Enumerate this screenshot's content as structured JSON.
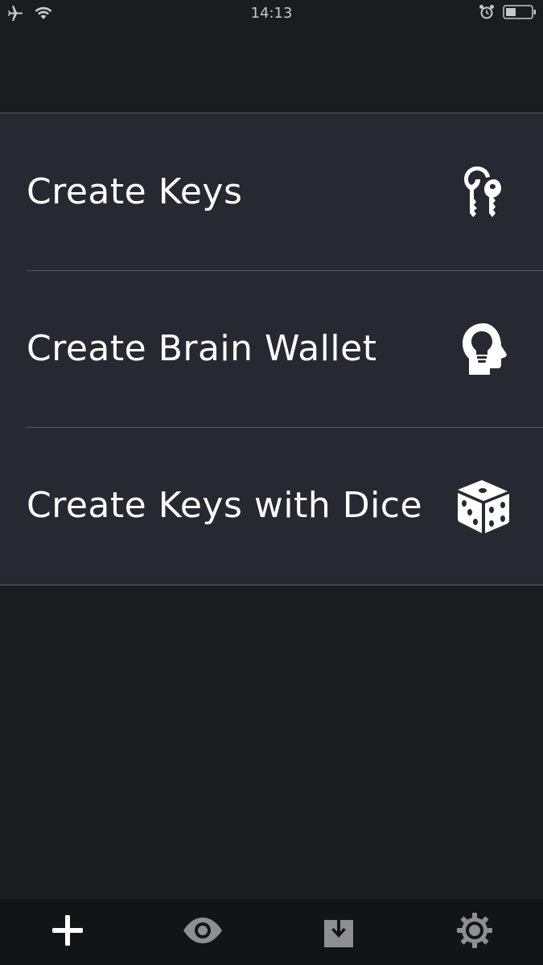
{
  "status_bar": {
    "time": "14:13",
    "left_icons": [
      "airplane-icon",
      "wifi-icon"
    ],
    "right_icons": [
      "alarm-icon",
      "battery-icon"
    ]
  },
  "menu": {
    "items": [
      {
        "label": "Create Keys",
        "icon": "keys-icon"
      },
      {
        "label": "Create Brain Wallet",
        "icon": "brain-head-icon"
      },
      {
        "label": "Create Keys with Dice",
        "icon": "dice-icon"
      }
    ]
  },
  "tab_bar": {
    "tabs": [
      {
        "icon": "plus-icon",
        "active": true
      },
      {
        "icon": "eye-icon",
        "active": false
      },
      {
        "icon": "import-icon",
        "active": false
      },
      {
        "icon": "gear-icon",
        "active": false
      }
    ]
  },
  "colors": {
    "background": "#1b1c1f",
    "list_background": "#272932",
    "separator": "#5a5c63",
    "tab_bar": "#131416",
    "active_tab": "#ffffff",
    "inactive_tab": "#8e8e93"
  }
}
